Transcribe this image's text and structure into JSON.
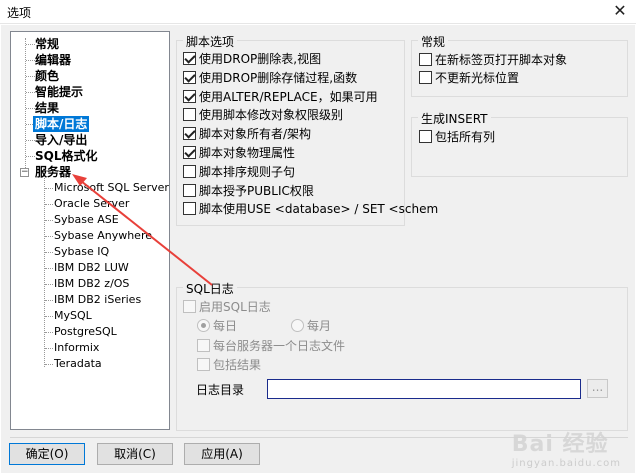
{
  "window": {
    "title": "选项",
    "close_glyph": "✕"
  },
  "tree": {
    "items": [
      {
        "label": "常规"
      },
      {
        "label": "编辑器"
      },
      {
        "label": "颜色"
      },
      {
        "label": "智能提示"
      },
      {
        "label": "结果"
      },
      {
        "label": "脚本/日志",
        "selected": true
      },
      {
        "label": "导入/导出"
      },
      {
        "label": "SQL格式化"
      },
      {
        "label": "服务器",
        "expander": "−"
      }
    ],
    "servers": [
      "Microsoft SQL Server",
      "Oracle Server",
      "Sybase ASE",
      "Sybase Anywhere",
      "Sybase IQ",
      "IBM DB2 LUW",
      "IBM DB2 z/OS",
      "IBM DB2 iSeries",
      "MySQL",
      "PostgreSQL",
      "Informix",
      "Teradata"
    ]
  },
  "script_options": {
    "title": "脚本选项",
    "items": [
      {
        "label": "使用DROP删除表,视图",
        "checked": true
      },
      {
        "label": "使用DROP删除存储过程,函数",
        "checked": true
      },
      {
        "label": "使用ALTER/REPLACE，如果可用",
        "checked": true
      },
      {
        "label": "使用脚本修改对象权限级别",
        "checked": false
      },
      {
        "label": "脚本对象所有者/架构",
        "checked": true
      },
      {
        "label": "脚本对象物理属性",
        "checked": true
      },
      {
        "label": "脚本排序规则子句",
        "checked": false
      },
      {
        "label": "脚本授予PUBLIC权限",
        "checked": false
      },
      {
        "label": "脚本使用USE <database> / SET <schem",
        "checked": false
      }
    ]
  },
  "general": {
    "title": "常规",
    "items": [
      {
        "label": "在新标签页打开脚本对象",
        "checked": false
      },
      {
        "label": "不更新光标位置",
        "checked": false
      }
    ]
  },
  "generate_insert": {
    "title": "生成INSERT",
    "items": [
      {
        "label": "包括所有列",
        "checked": false
      }
    ]
  },
  "sql_log": {
    "title": "SQL日志",
    "enable_label": "启用SQL日志",
    "radio_daily": "每日",
    "radio_monthly": "每月",
    "per_server_label": "每台服务器一个日志文件",
    "include_results_label": "包括结果",
    "dir_label": "日志目录",
    "dir_value": "",
    "browse_label": "..."
  },
  "buttons": {
    "ok": "确定(O)",
    "cancel": "取消(C)",
    "apply": "应用(A)"
  },
  "watermark": {
    "main": "Bai 经验",
    "sub": "jingyan.baidu.com"
  },
  "colors": {
    "selection": "#0078d7",
    "arrow": "#e8403a",
    "window_bg": "#f0f0f0"
  }
}
